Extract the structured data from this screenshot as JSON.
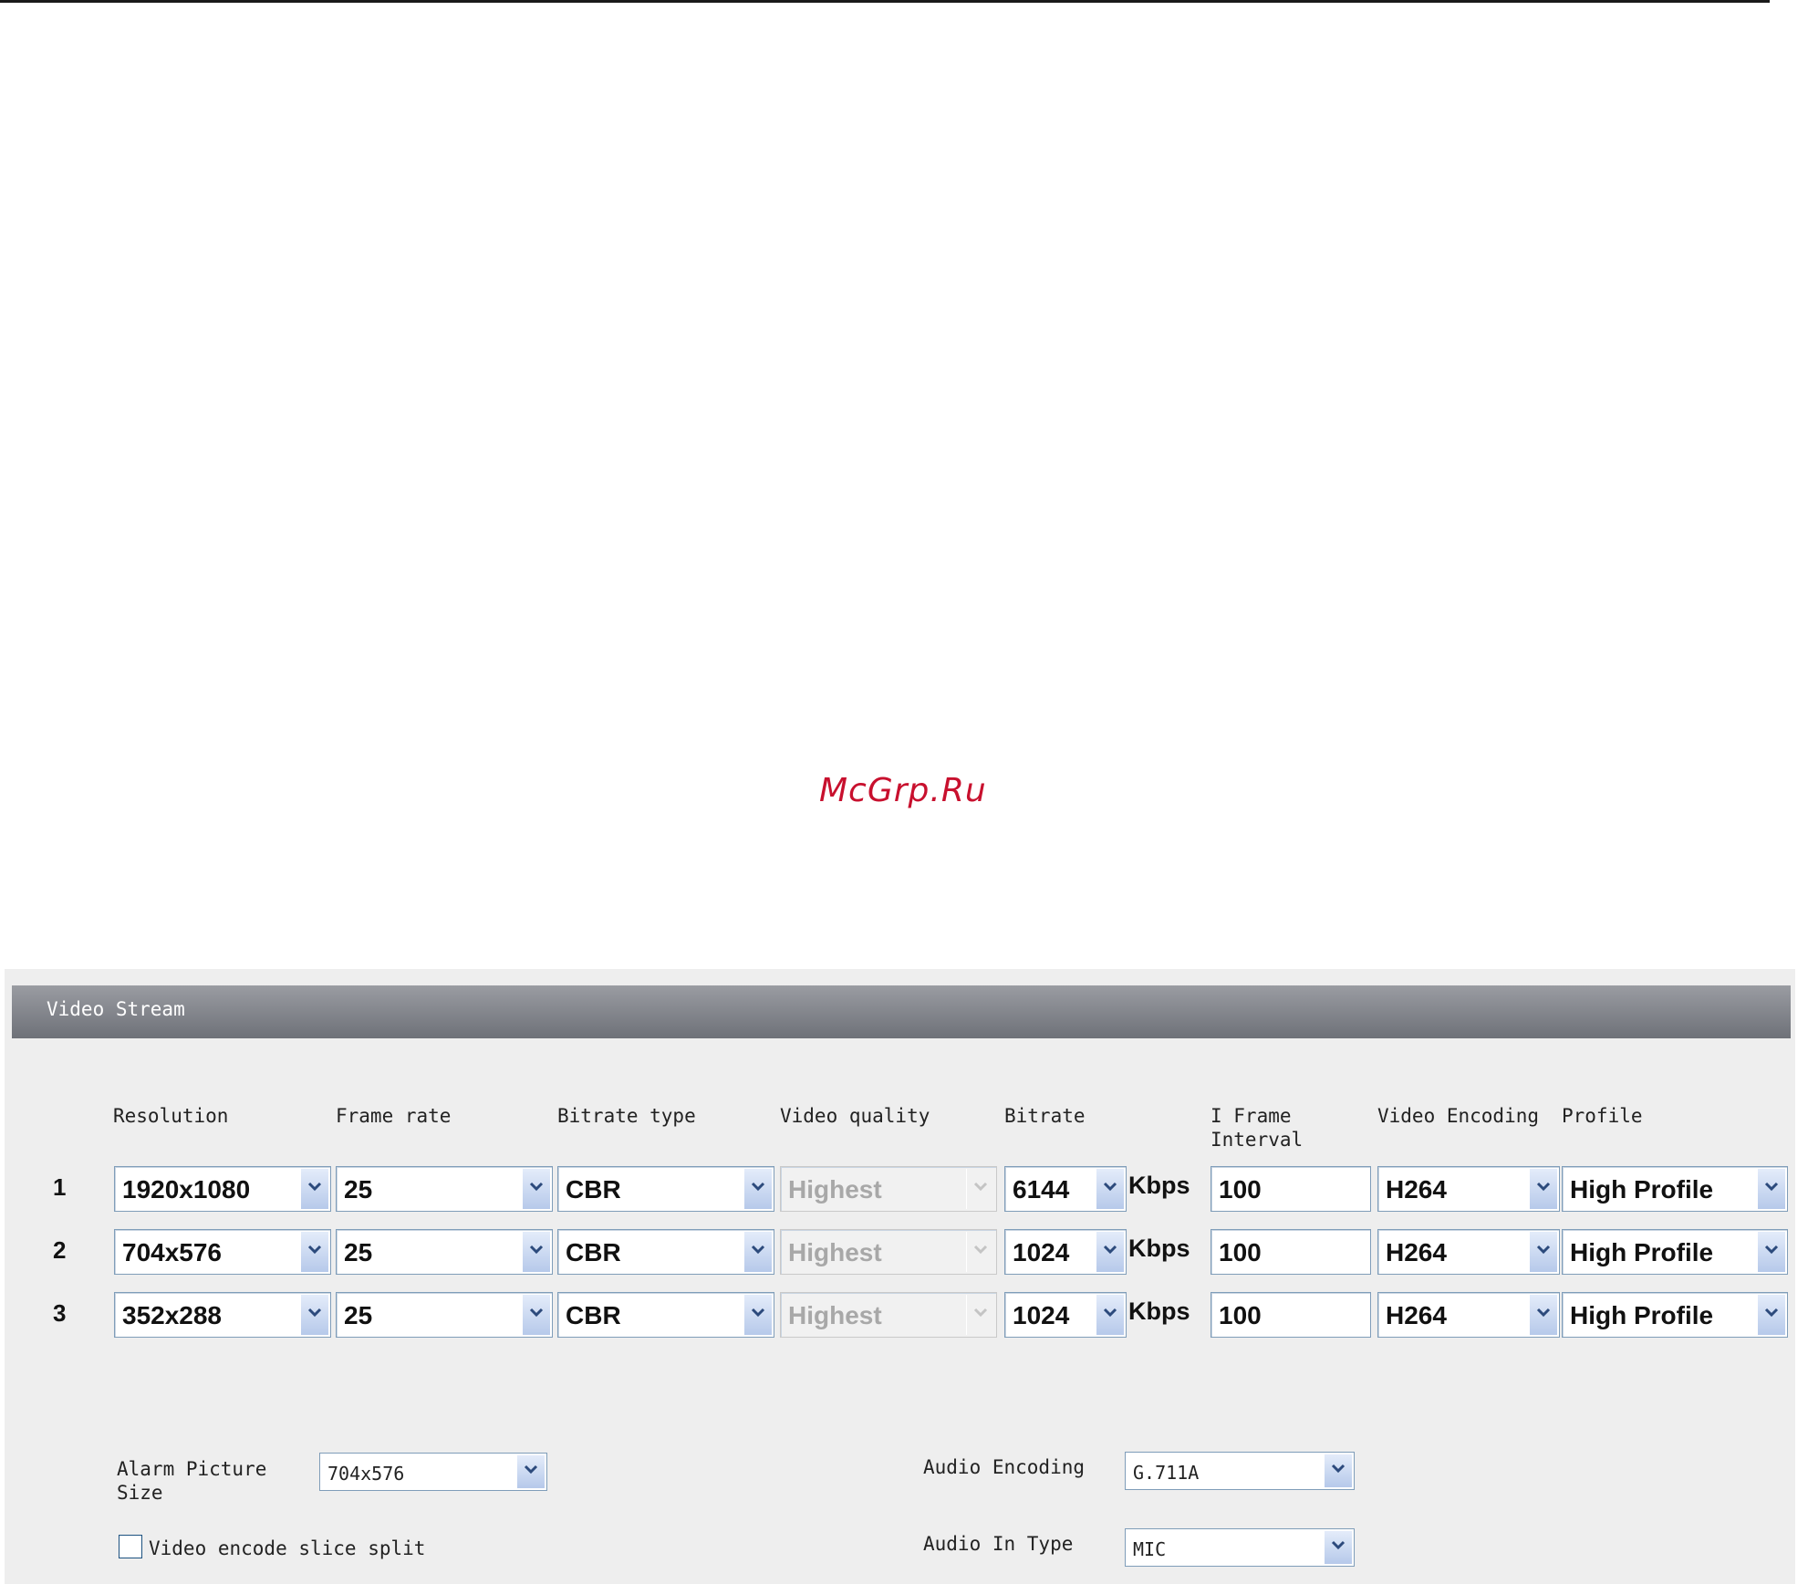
{
  "watermark": "McGrp.Ru",
  "panel": {
    "title": "Video Stream",
    "columns": [
      "Resolution",
      "Frame rate",
      "Bitrate type",
      "Video quality",
      "Bitrate",
      "I Frame\nInterval",
      "Video Encoding",
      "Profile"
    ],
    "unit": "Kbps",
    "rows": [
      {
        "num": "1",
        "resolution": "1920x1080",
        "frame_rate": "25",
        "bitrate_type": "CBR",
        "video_quality": "Highest",
        "bitrate": "6144",
        "iframe": "100",
        "encoding": "H264",
        "profile": "High Profile"
      },
      {
        "num": "2",
        "resolution": "704x576",
        "frame_rate": "25",
        "bitrate_type": "CBR",
        "video_quality": "Highest",
        "bitrate": "1024",
        "iframe": "100",
        "encoding": "H264",
        "profile": "High Profile"
      },
      {
        "num": "3",
        "resolution": "352x288",
        "frame_rate": "25",
        "bitrate_type": "CBR",
        "video_quality": "Highest",
        "bitrate": "1024",
        "iframe": "100",
        "encoding": "H264",
        "profile": "High Profile"
      }
    ],
    "alarm_picture_size": {
      "label": "Alarm Picture\nSize",
      "value": "704x576"
    },
    "slice_split": {
      "label": "Video encode slice split",
      "checked": false
    },
    "audio_encoding": {
      "label": "Audio Encoding",
      "value": "G.711A"
    },
    "audio_in_type": {
      "label": "Audio In Type",
      "value": "MIC"
    }
  },
  "icons": {
    "dropdown": "chevron-down-icon",
    "checkbox": "checkbox-icon"
  }
}
